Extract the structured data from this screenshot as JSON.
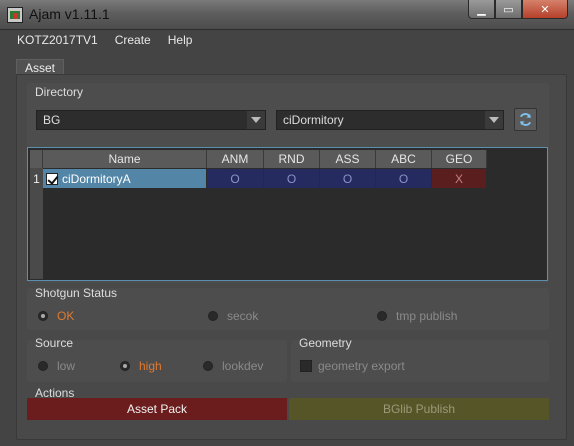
{
  "window": {
    "title": "Ajam v1.11.1",
    "minimize": "▁",
    "maximize": "▭",
    "close": "✕"
  },
  "menu": [
    "KOTZ2017TV1",
    "Create",
    "Help"
  ],
  "tab": {
    "label": "Asset"
  },
  "directory": {
    "title": "Directory",
    "combo1": "BG",
    "combo2": "ciDormitory",
    "refresh_icon": "refresh-icon"
  },
  "table": {
    "headers": [
      "Name",
      "ANM",
      "RND",
      "ASS",
      "ABC",
      "GEO"
    ],
    "rows": [
      {
        "index": "1",
        "checked": true,
        "name": "ciDormitoryA",
        "anm": "O",
        "rnd": "O",
        "ass": "O",
        "abc": "O",
        "geo": "X"
      }
    ]
  },
  "shotgun": {
    "title": "Shotgun Status",
    "options": [
      "OK",
      "secok",
      "tmp publish"
    ],
    "selected": "OK"
  },
  "source": {
    "title": "Source",
    "options": [
      "low",
      "high",
      "lookdev"
    ],
    "selected": "high"
  },
  "geometry": {
    "title": "Geometry",
    "checkbox_label": "geometry export"
  },
  "actions": {
    "title": "Actions",
    "asset_pack": "Asset Pack",
    "bglib_publish": "BGlib Publish"
  },
  "colors": {
    "accent_orange": "#e07a2e",
    "selection_blue": "#5285a6",
    "pack_red": "#6b1c1c",
    "publish_olive": "#555528"
  }
}
